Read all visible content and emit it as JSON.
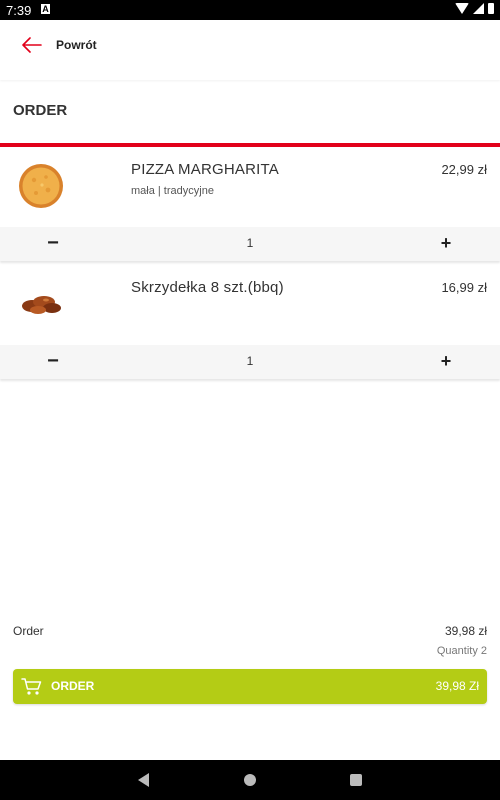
{
  "status_bar": {
    "time": "7:39",
    "notification_glyph": "A"
  },
  "header": {
    "back_label": "Powrót",
    "accent_color": "#e2001a"
  },
  "section_title": "ORDER",
  "items": [
    {
      "name": "PIZZA MARGHARITA",
      "subtitle": "mała | tradycyjne",
      "price": "22,99 zł",
      "quantity": "1",
      "image": "pizza-image"
    },
    {
      "name": "Skrzydełka 8 szt.(bbq)",
      "subtitle": "",
      "price": "16,99 zł",
      "quantity": "1",
      "image": "chicken-wings-image"
    }
  ],
  "qty_controls": {
    "minus": "−",
    "plus": "+"
  },
  "summary": {
    "label": "Order",
    "total": "39,98 zł",
    "quantity_text": "Quantity 2"
  },
  "order_button": {
    "label": "ORDER",
    "amount": "39,98 Zł",
    "color": "#b4cc15"
  }
}
